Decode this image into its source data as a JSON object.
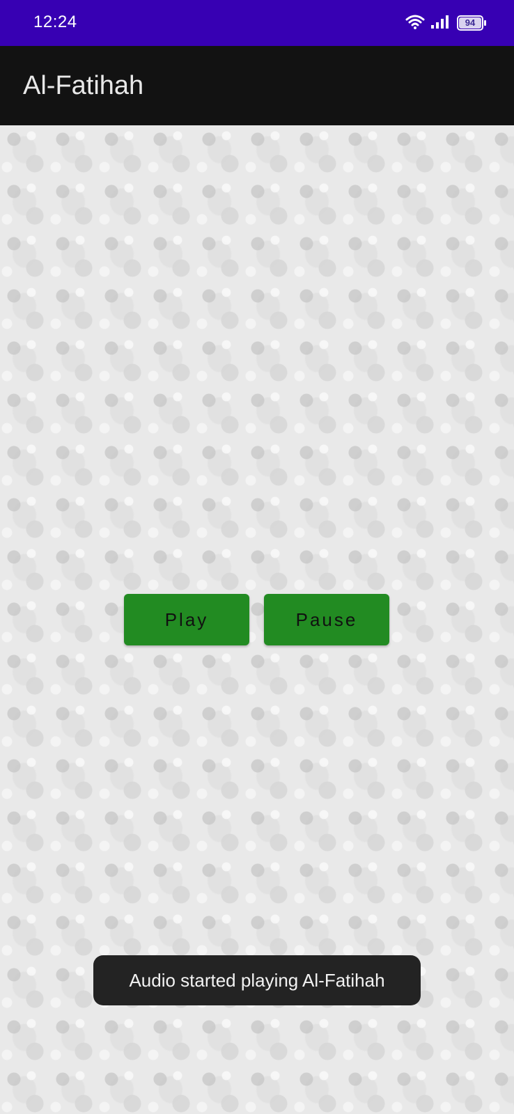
{
  "status_bar": {
    "time": "12:24",
    "battery": "94",
    "background_color": "#3700b3",
    "icons": [
      "wifi-icon",
      "signal-icon",
      "battery-icon"
    ]
  },
  "app_bar": {
    "title": "Al-Fatihah",
    "background_color": "#121212"
  },
  "controls": {
    "play_label": "Play",
    "pause_label": "Pause",
    "button_color": "#228b22"
  },
  "toast": {
    "message": "Audio started playing Al-Fatihah"
  }
}
